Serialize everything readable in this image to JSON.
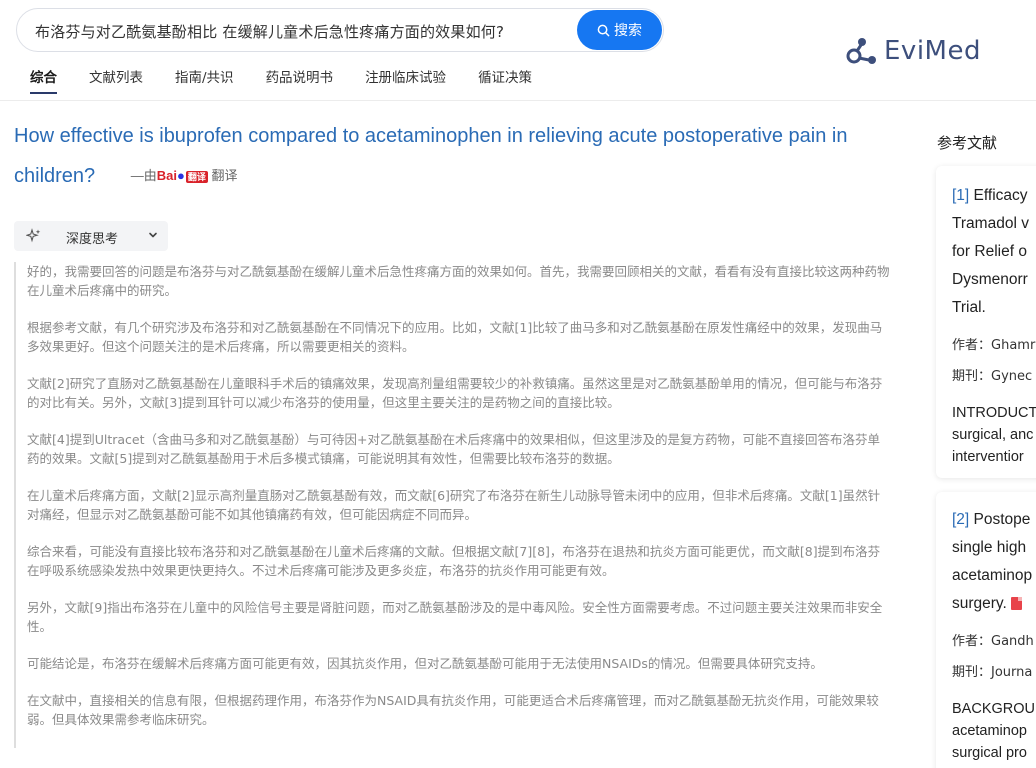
{
  "search": {
    "query": "布洛芬与对乙酰氨基酚相比 在缓解儿童术后急性疼痛方面的效果如何?",
    "button_label": "搜索"
  },
  "logo": {
    "text": "EviMed"
  },
  "tabs": [
    {
      "label": "综合",
      "active": true
    },
    {
      "label": "文献列表",
      "active": false
    },
    {
      "label": "指南/共识",
      "active": false
    },
    {
      "label": "药品说明书",
      "active": false
    },
    {
      "label": "注册临床试验",
      "active": false
    },
    {
      "label": "循证决策",
      "active": false
    }
  ],
  "question": {
    "translated_title": "How effective is ibuprofen compared to acetaminophen in relieving acute postoperative pain in children?",
    "translated_by_prefix": "—由",
    "translated_by_brand": "Bai",
    "translated_by_suffix": "翻译",
    "translated_by_badge": "翻译"
  },
  "deep_think": {
    "label": "深度思考"
  },
  "thoughts": [
    "好的，我需要回答的问题是布洛芬与对乙酰氨基酚在缓解儿童术后急性疼痛方面的效果如何。首先，我需要回顾相关的文献，看看有没有直接比较这两种药物在儿童术后疼痛中的研究。",
    "根据参考文献，有几个研究涉及布洛芬和对乙酰氨基酚在不同情况下的应用。比如，文献[1]比较了曲马多和对乙酰氨基酚在原发性痛经中的效果，发现曲马多效果更好。但这个问题关注的是术后疼痛，所以需要更相关的资料。",
    "文献[2]研究了直肠对乙酰氨基酚在儿童眼科手术后的镇痛效果，发现高剂量组需要较少的补救镇痛。虽然这里是对乙酰氨基酚单用的情况，但可能与布洛芬的对比有关。另外，文献[3]提到耳针可以减少布洛芬的使用量，但这里主要关注的是药物之间的直接比较。",
    "文献[4]提到Ultracet（含曲马多和对乙酰氨基酚）与可待因+对乙酰氨基酚在术后疼痛中的效果相似，但这里涉及的是复方药物，可能不直接回答布洛芬单药的效果。文献[5]提到对乙酰氨基酚用于术后多模式镇痛，可能说明其有效性，但需要比较布洛芬的数据。",
    "在儿童术后疼痛方面，文献[2]显示高剂量直肠对乙酰氨基酚有效，而文献[6]研究了布洛芬在新生儿动脉导管未闭中的应用，但非术后疼痛。文献[1]虽然针对痛经，但显示对乙酰氨基酚可能不如其他镇痛药有效，但可能因病症不同而异。",
    "综合来看，可能没有直接比较布洛芬和对乙酰氨基酚在儿童术后疼痛的文献。但根据文献[7][8]，布洛芬在退热和抗炎方面可能更优，而文献[8]提到布洛芬在呼吸系统感染发热中效果更快更持久。不过术后疼痛可能涉及更多炎症，布洛芬的抗炎作用可能更有效。",
    "另外，文献[9]指出布洛芬在儿童中的风险信号主要是肾脏问题，而对乙酰氨基酚涉及的是中毒风险。安全性方面需要考虑。不过问题主要关注效果而非安全性。",
    "可能结论是，布洛芬在缓解术后疼痛方面可能更有效，因其抗炎作用，但对乙酰氨基酚可能用于无法使用NSAIDs的情况。但需要具体研究支持。",
    "在文献中，直接相关的信息有限，但根据药理作用，布洛芬作为NSAID具有抗炎作用，可能更适合术后疼痛管理，而对乙酰氨基酚无抗炎作用，可能效果较弱。但具体效果需参考临床研究。"
  ],
  "references": {
    "heading": "参考文献",
    "items": [
      {
        "num": "[1]",
        "title_lines": [
          "Efficacy",
          "Tramadol v",
          "for Relief o",
          "Dysmenorr",
          "Trial."
        ],
        "author_label": "作者：",
        "author": "Ghamr",
        "journal_label": "期刊：",
        "journal": "Gynec",
        "abstract_lines": [
          "INTRODUCT",
          "surgical, anc",
          "interventior"
        ]
      },
      {
        "num": "[2]",
        "title_lines": [
          "Postope",
          "single high",
          "acetaminop",
          "surgery."
        ],
        "author_label": "作者：",
        "author": "Gandh",
        "journal_label": "期刊：",
        "journal": "Journa",
        "abstract_lines": [
          "BACKGROU",
          "acetaminop",
          "surgical pro"
        ]
      }
    ]
  },
  "colors": {
    "accent_blue": "#1677f2",
    "title_blue": "#2a6bb5",
    "logo_navy": "#3d4f7c"
  }
}
